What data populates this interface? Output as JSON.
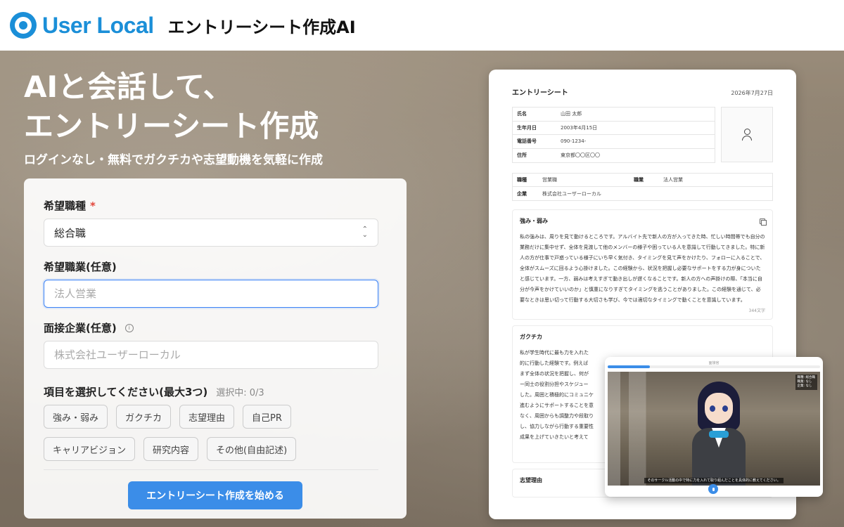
{
  "header": {
    "logo_text": "User Local",
    "app_title": "エントリーシート作成AI"
  },
  "hero": {
    "title_line1": "AIと会話して、",
    "title_line2": "エントリーシート作成",
    "subtitle": "ログインなし・無料でガクチカや志望動機を気軽に作成"
  },
  "form": {
    "job_type_label": "希望職種",
    "required_mark": "*",
    "job_type_value": "総合職",
    "occupation_label": "希望職業(任意)",
    "occupation_placeholder": "法人営業",
    "company_label": "面接企業(任意)",
    "company_info_icon": "i",
    "company_placeholder": "株式会社ユーザーローカル",
    "items_label": "項目を選択してください(最大3つ)",
    "items_count": "選択中: 0/3",
    "chips_row1": [
      "強み・弱み",
      "ガクチカ",
      "志望理由",
      "自己PR"
    ],
    "chips_row2": [
      "キャリアビジョン",
      "研究内容",
      "その他(自由記述)"
    ],
    "start_button": "エントリーシート作成を始める"
  },
  "sheet": {
    "title": "エントリーシート",
    "date": "2026年7月27日",
    "profile": [
      {
        "key": "氏名",
        "value": "山田 太郎"
      },
      {
        "key": "生年月日",
        "value": "2003年4月15日"
      },
      {
        "key": "電話番号",
        "value": "090-1234-"
      },
      {
        "key": "住所",
        "value": "東京都〇〇区〇〇"
      }
    ],
    "job_row": {
      "key1": "職種",
      "val1": "営業職",
      "key2": "職業",
      "val2": "法人営業"
    },
    "company_row": {
      "key": "企業",
      "value": "株式会社ユーザーローカル"
    },
    "strengths": {
      "title": "強み・弱み",
      "body": "私の強みは、周りを見て動けるところです。アルバイト先で新人の方が入ってきた時、忙しい時間帯でも自分の業務だけに集中せず、全体を見渡して他のメンバーの様子や困っている人を意識して行動してきました。特に新人の方が仕事で戸惑っている様子にいち早く気付き、タイミングを見て声をかけたり、フォローに入ることで、全体がスムーズに回るよう心掛けました。この経験から、状況を把握し必要なサポートをする力が身についたと感じています。一方、弱みは考えすぎて動き出しが遅くなることです。新人の方への声掛けの際、「本当に自分が今声をかけていいのか」と慎重になりすぎてタイミングを逃うことがありました。この経験を通じて、必要なときは思い切って行動する大切さも学び、今では適切なタイミングで動くことを意識しています。",
      "char_count": "344文字"
    },
    "gakuchika": {
      "title": "ガクチカ",
      "lines": [
        "私が学生時代に最も力を入れた",
        "的に行動した経験です。例えば",
        "まず全体の状況を把握し、何が",
        "ー同士の役割分担やスケジュー",
        "した。周囲と積極的にコミュニケ",
        "進むようにサポートすることを意",
        "なく、周囲からも調整力や段取り",
        "し、協力しながら行動する重要性",
        "成果を上げていきたいと考えて"
      ]
    },
    "motivation": {
      "title": "志望理由"
    }
  },
  "video": {
    "top_label": "面接官",
    "progress_percent": 20,
    "info_lines": [
      "職種: 総合職",
      "職業: なし",
      "企業: なし"
    ],
    "subtitle": "そのサークル活動の中で特に力を入れて取り組んだことを具体的に教えてください。"
  }
}
